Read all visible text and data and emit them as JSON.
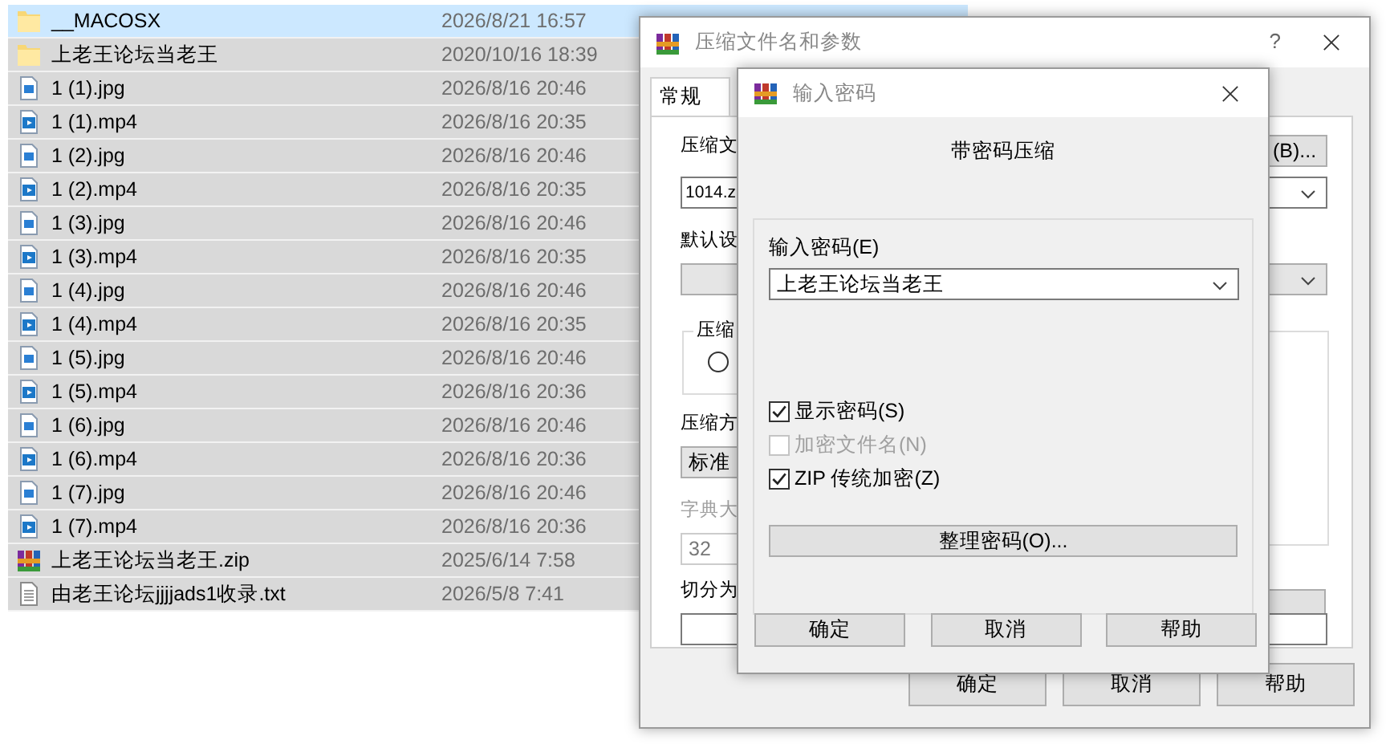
{
  "file_list": {
    "rows": [
      {
        "name": "__MACOSX",
        "modified": "2026/8/21 16:57",
        "kind": "folder",
        "selected": false,
        "hover": true
      },
      {
        "name": "上老王论坛当老王",
        "modified": "2020/10/16 18:39",
        "kind": "folder",
        "selected": true,
        "hover": false
      },
      {
        "name": "1 (1).jpg",
        "modified": "2026/8/16 20:46",
        "kind": "image",
        "selected": true,
        "hover": false
      },
      {
        "name": "1 (1).mp4",
        "modified": "2026/8/16 20:35",
        "kind": "video",
        "selected": true,
        "hover": false
      },
      {
        "name": "1 (2).jpg",
        "modified": "2026/8/16 20:46",
        "kind": "image",
        "selected": true,
        "hover": false
      },
      {
        "name": "1 (2).mp4",
        "modified": "2026/8/16 20:35",
        "kind": "video",
        "selected": true,
        "hover": false
      },
      {
        "name": "1 (3).jpg",
        "modified": "2026/8/16 20:46",
        "kind": "image",
        "selected": true,
        "hover": false
      },
      {
        "name": "1 (3).mp4",
        "modified": "2026/8/16 20:35",
        "kind": "video",
        "selected": true,
        "hover": false
      },
      {
        "name": "1 (4).jpg",
        "modified": "2026/8/16 20:46",
        "kind": "image",
        "selected": true,
        "hover": false
      },
      {
        "name": "1 (4).mp4",
        "modified": "2026/8/16 20:35",
        "kind": "video",
        "selected": true,
        "hover": false
      },
      {
        "name": "1 (5).jpg",
        "modified": "2026/8/16 20:46",
        "kind": "image",
        "selected": true,
        "hover": false
      },
      {
        "name": "1 (5).mp4",
        "modified": "2026/8/16 20:36",
        "kind": "video",
        "selected": true,
        "hover": false
      },
      {
        "name": "1 (6).jpg",
        "modified": "2026/8/16 20:46",
        "kind": "image",
        "selected": true,
        "hover": false
      },
      {
        "name": "1 (6).mp4",
        "modified": "2026/8/16 20:36",
        "kind": "video",
        "selected": true,
        "hover": false
      },
      {
        "name": "1 (7).jpg",
        "modified": "2026/8/16 20:46",
        "kind": "image",
        "selected": true,
        "hover": false
      },
      {
        "name": "1 (7).mp4",
        "modified": "2026/8/16 20:36",
        "kind": "video",
        "selected": true,
        "hover": false
      },
      {
        "name": "上老王论坛当老王.zip",
        "modified": "2025/6/14 7:58",
        "kind": "archive",
        "selected": true,
        "hover": false
      },
      {
        "name": "由老王论坛jjjjads1收录.txt",
        "modified": "2026/5/8 7:41",
        "kind": "text",
        "selected": true,
        "hover": false
      }
    ]
  },
  "compress_dialog": {
    "title": "压缩文件名和参数",
    "help_glyph": "?",
    "tabs": [
      {
        "label": "常规",
        "selected": true
      }
    ],
    "archive_name_label": "压缩文",
    "browse_button": "(B)...",
    "archive_name_value": "1014.z",
    "profile_label": "默认设",
    "format_group_label": "压缩",
    "format_radio": {
      "selected": false
    },
    "method": {
      "label": "压缩方",
      "value": "标准"
    },
    "dictionary": {
      "label": "字典大",
      "value": "32",
      "disabled": true
    },
    "split_label": "切分为",
    "buttons": [
      "确定",
      "取消",
      "帮助"
    ]
  },
  "password_dialog": {
    "title": "输入密码",
    "heading": "带密码压缩",
    "password_label": "输入密码(E)",
    "password_value": "上老王论坛当老王",
    "options": [
      {
        "label": "显示密码(S)",
        "checked": true,
        "disabled": false
      },
      {
        "label": "加密文件名(N)",
        "checked": false,
        "disabled": true
      },
      {
        "label": "ZIP 传统加密(Z)",
        "checked": true,
        "disabled": false
      }
    ],
    "organize_button": "整理密码(O)...",
    "buttons": [
      "确定",
      "取消",
      "帮助"
    ]
  }
}
